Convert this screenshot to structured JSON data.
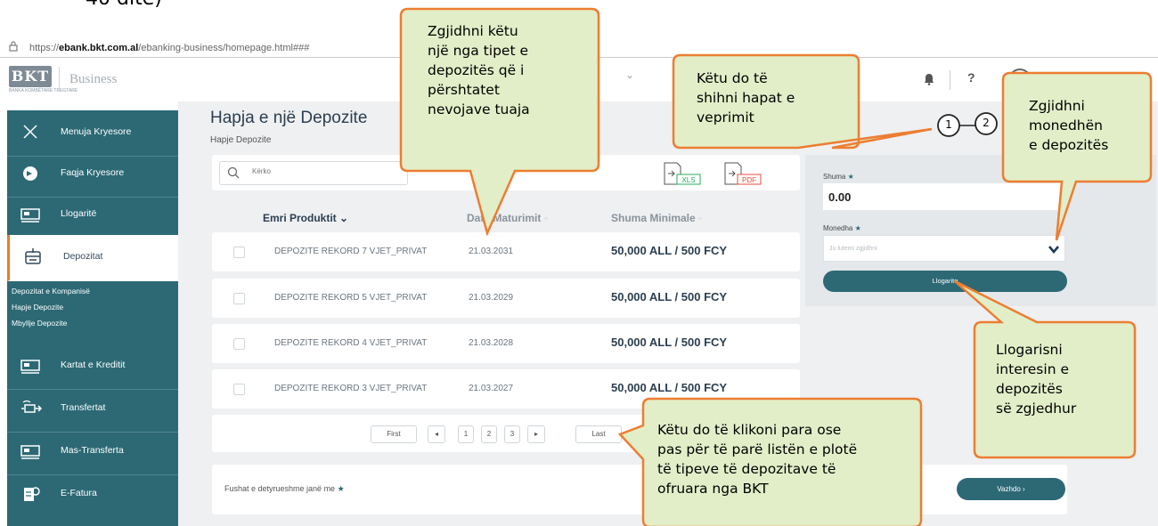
{
  "doc_snippet": "40 ditë)",
  "browser": {
    "url_prefix": "https://",
    "url_domain": "ebank.bkt.com.al",
    "url_path": "/ebanking-business/homepage.html###"
  },
  "header": {
    "logo": "BKT",
    "logo_sub": "BANKA KOMBËTARE TREGTARE",
    "brand": "Business",
    "help": "?"
  },
  "sidebar": {
    "items": [
      {
        "label": "Menuja Kryesore",
        "icon": "close-icon"
      },
      {
        "label": "Faqja Kryesore",
        "icon": "home-icon"
      },
      {
        "label": "Llogaritë",
        "icon": "card-icon"
      },
      {
        "label": "Depozitat",
        "icon": "deposit-icon"
      },
      {
        "label": "Kartat e Kreditit",
        "icon": "card-icon"
      },
      {
        "label": "Transfertat",
        "icon": "transfer-icon"
      },
      {
        "label": "Mas-Transferta",
        "icon": "card-icon"
      },
      {
        "label": "E-Fatura",
        "icon": "invoice-icon"
      }
    ],
    "sub_items": [
      "Depozitat e Kompanisë",
      "Hapje Depozite",
      "Mbyllje Depozite"
    ]
  },
  "page": {
    "title": "Hapja e një Depozite",
    "breadcrumb": "Hapje Depozite"
  },
  "search": {
    "placeholder": "Kërko"
  },
  "export": {
    "xls": "XLS",
    "pdf": "PDF"
  },
  "table": {
    "columns": [
      "Emri Produktit",
      "Data Maturimit",
      "Shuma Minimale"
    ],
    "rows": [
      {
        "name": "DEPOZITE REKORD 7 VJET_PRIVAT",
        "date": "21.03.2031",
        "amount": "50,000 ALL / 500 FCY"
      },
      {
        "name": "DEPOZITE REKORD 5 VJET_PRIVAT",
        "date": "21.03.2029",
        "amount": "50,000 ALL / 500 FCY"
      },
      {
        "name": "DEPOZITE REKORD 4 VJET_PRIVAT",
        "date": "21.03.2028",
        "amount": "50,000 ALL / 500 FCY"
      },
      {
        "name": "DEPOZITE REKORD 3 VJET_PRIVAT",
        "date": "21.03.2027",
        "amount": "50,000 ALL / 500 FCY"
      }
    ]
  },
  "pagination": {
    "first": "First",
    "prev": "◂",
    "pages": [
      "1",
      "2",
      "3"
    ],
    "next": "▸",
    "last": "Last"
  },
  "footer": {
    "required_note": "Fushat e detyrueshme janë me",
    "next_button": "Vazhdo ›"
  },
  "steps": [
    "1",
    "2"
  ],
  "form": {
    "amount_label": "Shuma",
    "amount_value": "0.00",
    "currency_label": "Monedha",
    "currency_placeholder": "Ju lutemi zgjidhni",
    "calc_button": "Llogarite"
  },
  "callouts": {
    "type": [
      "Zgjidhni këtu",
      "një nga tipet e",
      "depozitës që i",
      "përshtatet",
      "nevojave tuaja"
    ],
    "steps": [
      "Këtu do të",
      "shihni hapat e",
      "veprimit"
    ],
    "currency": [
      "Zgjidhni",
      "monedhën",
      "e depozitës"
    ],
    "calc": [
      "Llogarisni",
      "interesin e",
      "depozitës",
      "së zgjedhur"
    ],
    "paging": [
      "Këtu do të klikoni para ose",
      "pas për të parë listën e plotë",
      "të tipeve të depozitave të",
      "ofruara nga BKT"
    ]
  },
  "colors": {
    "sidebar": "#2c6975",
    "accent": "#e67e22",
    "callout_fill": "#e2eec8",
    "callout_stroke": "#ed7d31"
  }
}
